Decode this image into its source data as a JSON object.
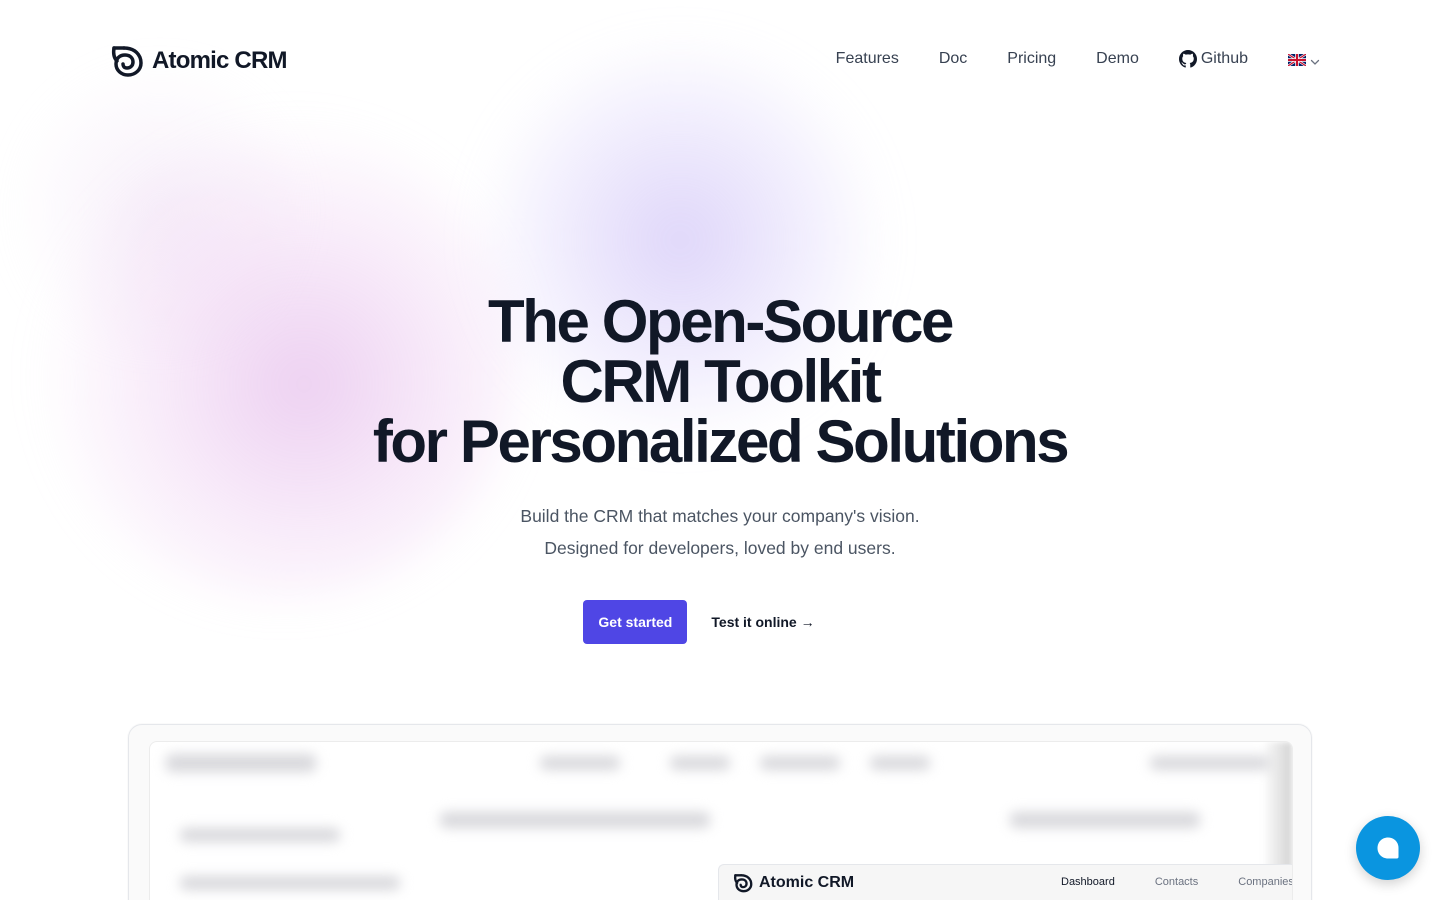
{
  "header": {
    "brand": "Atomic CRM",
    "nav": [
      {
        "label": "Features"
      },
      {
        "label": "Doc"
      },
      {
        "label": "Pricing"
      },
      {
        "label": "Demo"
      },
      {
        "label": "Github",
        "icon": "github-icon"
      }
    ],
    "language": {
      "icon": "uk-flag-icon",
      "dropdown_icon": "chevron-down-icon"
    }
  },
  "hero": {
    "title_lines": [
      "The Open-Source",
      "CRM Toolkit",
      "for Personalized Solutions"
    ],
    "subtitle_lines": [
      "Build the CRM that matches your company's vision.",
      "Designed for developers, loved by end users."
    ],
    "primary_cta": "Get started",
    "secondary_cta": "Test it online →"
  },
  "preview": {
    "app_brand": "Atomic CRM",
    "tabs": [
      {
        "label": "Dashboard",
        "active": true
      },
      {
        "label": "Contacts",
        "active": false
      },
      {
        "label": "Companies",
        "active": false
      }
    ]
  },
  "colors": {
    "primary": "#4f46e5",
    "text": "#111827",
    "muted": "#4b5563",
    "chat": "#0a95e0"
  },
  "chat": {
    "icon": "chat-bubble-icon"
  }
}
